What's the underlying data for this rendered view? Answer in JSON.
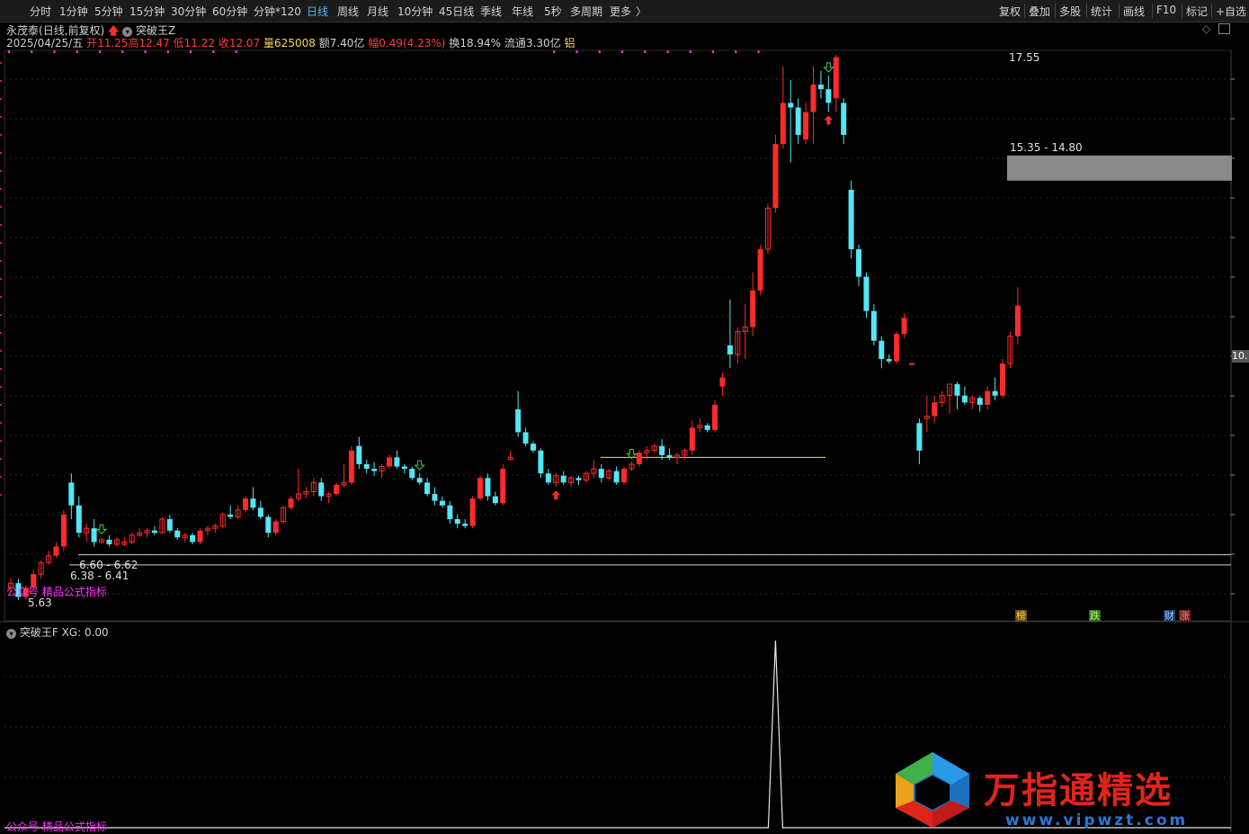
{
  "toolbar": {
    "periods": [
      "分时",
      "1分钟",
      "5分钟",
      "15分钟",
      "30分钟",
      "60分钟",
      "分钟*120",
      "日线",
      "周线",
      "月线",
      "10分钟",
      "45日线",
      "季线",
      "年线",
      "5秒",
      "多周期",
      "更多"
    ],
    "active_period": "日线",
    "tools": [
      "复权",
      "叠加",
      "多股",
      "统计",
      "画线",
      "F10",
      "标记",
      "+自选"
    ]
  },
  "stock": {
    "name": "永茂泰",
    "mode": "(日线,前复权)",
    "indicator": "突破王Z",
    "date": "2025/04/25/五",
    "open_label": "开",
    "open": "11.25",
    "high_label": "高",
    "high": "12.47",
    "low_label": "低",
    "low": "11.22",
    "close_label": "收",
    "close": "12.07",
    "volume_label": "量",
    "volume": "625008",
    "amount_label": "额",
    "amount": "7.40亿",
    "change_label": "幅",
    "change": "0.49(4.23%)",
    "turnover_label": "换",
    "turnover": "18.94%",
    "float_label": "流通",
    "float": "3.30亿",
    "tag": "铝"
  },
  "annotations": {
    "high_price": "17.55",
    "zone_upper": "15.35 - 14.80",
    "zone_lower_1": "6.60 - 6.62",
    "zone_lower_2": "6.38 - 6.41",
    "low_price": "5.63",
    "right_axis_price": "10.",
    "watermark_main": "公众号 精品公式指标",
    "badge_1": "榜",
    "badge_2": "跌",
    "badge_3": "财",
    "badge_4": "涨"
  },
  "indicator_panel": {
    "title": "突破王F",
    "value_label": "XG:",
    "value": "0.00",
    "watermark": "公众号 精品公式指标"
  },
  "brand": {
    "name": "万指通精选",
    "url": "www.vipwzt.com"
  },
  "colors": {
    "up": "#ff2a2a",
    "down": "#54e6f4",
    "magenta": "#ff33ff",
    "yellow_line": "#e8e07a",
    "zone_fill": "#8a8a8a",
    "active_tab": "#4fb8ff",
    "brand_red": "#e0241c",
    "brand_blue": "#2a7ad6"
  },
  "chart_data": {
    "type": "candlestick",
    "x": "trading days (unlabeled)",
    "ohlc": [
      [
        5.9,
        6.1,
        5.8,
        6.0
      ],
      [
        6.0,
        6.1,
        5.63,
        5.7
      ],
      [
        5.7,
        5.95,
        5.65,
        5.9
      ],
      [
        5.9,
        6.3,
        5.85,
        6.2
      ],
      [
        6.2,
        6.5,
        6.1,
        6.45
      ],
      [
        6.45,
        6.7,
        6.4,
        6.6
      ],
      [
        6.6,
        6.9,
        6.55,
        6.8
      ],
      [
        6.8,
        7.6,
        6.7,
        7.5
      ],
      [
        8.2,
        8.4,
        7.4,
        7.7
      ],
      [
        7.7,
        7.9,
        7.0,
        7.1
      ],
      [
        7.1,
        7.3,
        6.9,
        7.2
      ],
      [
        7.2,
        7.4,
        6.8,
        6.9
      ],
      [
        6.9,
        7.0,
        6.85,
        6.95
      ],
      [
        6.95,
        7.05,
        6.8,
        6.85
      ],
      [
        6.85,
        7.0,
        6.8,
        6.95
      ],
      [
        6.85,
        7.0,
        6.8,
        6.9
      ],
      [
        6.9,
        7.1,
        6.85,
        7.05
      ],
      [
        7.05,
        7.2,
        7.0,
        7.1
      ],
      [
        7.1,
        7.2,
        7.0,
        7.15
      ],
      [
        7.15,
        7.25,
        7.05,
        7.1
      ],
      [
        7.1,
        7.45,
        7.1,
        7.4
      ],
      [
        7.4,
        7.5,
        7.1,
        7.15
      ],
      [
        7.15,
        7.2,
        6.95,
        7.0
      ],
      [
        7.0,
        7.1,
        6.9,
        7.05
      ],
      [
        7.05,
        7.1,
        6.85,
        6.9
      ],
      [
        6.9,
        7.2,
        6.85,
        7.15
      ],
      [
        7.15,
        7.25,
        7.05,
        7.2
      ],
      [
        7.2,
        7.3,
        7.1,
        7.25
      ],
      [
        7.25,
        7.55,
        7.2,
        7.5
      ],
      [
        7.5,
        7.7,
        7.4,
        7.45
      ],
      [
        7.45,
        7.7,
        7.4,
        7.6
      ],
      [
        7.6,
        7.9,
        7.55,
        7.85
      ],
      [
        7.85,
        8.1,
        7.6,
        7.65
      ],
      [
        7.65,
        7.8,
        7.4,
        7.45
      ],
      [
        7.45,
        7.5,
        7.0,
        7.1
      ],
      [
        7.1,
        7.4,
        7.05,
        7.35
      ],
      [
        7.35,
        7.7,
        7.3,
        7.65
      ],
      [
        7.65,
        7.9,
        7.6,
        7.85
      ],
      [
        7.85,
        8.5,
        7.8,
        7.95
      ],
      [
        7.95,
        8.1,
        7.85,
        8.0
      ],
      [
        8.0,
        8.3,
        7.9,
        8.2
      ],
      [
        8.2,
        8.3,
        7.8,
        7.9
      ],
      [
        7.9,
        8.0,
        7.75,
        7.95
      ],
      [
        7.95,
        8.2,
        7.9,
        8.15
      ],
      [
        8.15,
        8.6,
        8.1,
        8.2
      ],
      [
        8.2,
        9.0,
        8.15,
        8.9
      ],
      [
        9.0,
        9.2,
        8.5,
        8.6
      ],
      [
        8.6,
        8.7,
        8.4,
        8.5
      ],
      [
        8.5,
        8.65,
        8.35,
        8.45
      ],
      [
        8.45,
        8.6,
        8.3,
        8.55
      ],
      [
        8.55,
        8.8,
        8.5,
        8.75
      ],
      [
        8.75,
        8.9,
        8.5,
        8.55
      ],
      [
        8.55,
        8.6,
        8.4,
        8.5
      ],
      [
        8.5,
        8.55,
        8.25,
        8.3
      ],
      [
        8.3,
        8.4,
        8.15,
        8.2
      ],
      [
        8.2,
        8.3,
        7.9,
        7.95
      ],
      [
        7.95,
        8.1,
        7.7,
        7.8
      ],
      [
        7.8,
        7.9,
        7.65,
        7.7
      ],
      [
        7.7,
        7.8,
        7.3,
        7.4
      ],
      [
        7.4,
        7.5,
        7.2,
        7.3
      ],
      [
        7.3,
        7.4,
        7.2,
        7.25
      ],
      [
        7.25,
        7.9,
        7.2,
        7.85
      ],
      [
        7.85,
        8.35,
        7.8,
        8.3
      ],
      [
        8.3,
        8.4,
        7.8,
        7.9
      ],
      [
        7.9,
        8.0,
        7.7,
        7.75
      ],
      [
        7.75,
        8.6,
        7.7,
        8.5
      ],
      [
        8.7,
        8.9,
        8.7,
        8.75
      ],
      [
        9.8,
        10.2,
        9.2,
        9.3
      ],
      [
        9.3,
        9.4,
        9.0,
        9.05
      ],
      [
        9.05,
        9.1,
        8.85,
        8.9
      ],
      [
        8.9,
        8.95,
        8.3,
        8.4
      ],
      [
        8.4,
        8.5,
        8.15,
        8.2
      ],
      [
        8.2,
        8.4,
        8.1,
        8.35
      ],
      [
        8.35,
        8.45,
        8.15,
        8.2
      ],
      [
        8.2,
        8.35,
        8.1,
        8.3
      ],
      [
        8.3,
        8.35,
        8.15,
        8.25
      ],
      [
        8.25,
        8.45,
        8.2,
        8.4
      ],
      [
        8.4,
        8.7,
        8.3,
        8.5
      ],
      [
        8.5,
        8.6,
        8.2,
        8.3
      ],
      [
        8.3,
        8.5,
        8.25,
        8.45
      ],
      [
        8.45,
        8.55,
        8.15,
        8.2
      ],
      [
        8.2,
        8.55,
        8.15,
        8.5
      ],
      [
        8.5,
        8.65,
        8.45,
        8.6
      ],
      [
        8.6,
        8.9,
        8.55,
        8.85
      ],
      [
        8.85,
        9.0,
        8.7,
        8.9
      ],
      [
        8.9,
        9.05,
        8.85,
        9.0
      ],
      [
        9.0,
        9.15,
        8.7,
        8.8
      ],
      [
        8.8,
        8.95,
        8.7,
        8.75
      ],
      [
        8.75,
        8.85,
        8.6,
        8.8
      ],
      [
        8.8,
        8.95,
        8.7,
        8.9
      ],
      [
        8.9,
        9.55,
        8.8,
        9.4
      ],
      [
        9.4,
        9.6,
        9.3,
        9.45
      ],
      [
        9.45,
        9.5,
        9.3,
        9.35
      ],
      [
        9.35,
        10.0,
        9.3,
        9.9
      ],
      [
        10.3,
        10.6,
        10.1,
        10.5
      ],
      [
        11.2,
        12.2,
        10.7,
        11.0
      ],
      [
        11.0,
        11.6,
        10.8,
        11.5
      ],
      [
        11.5,
        12.1,
        10.9,
        11.6
      ],
      [
        11.6,
        12.8,
        11.4,
        12.4
      ],
      [
        12.4,
        13.4,
        12.3,
        13.3
      ],
      [
        13.3,
        14.3,
        13.2,
        14.2
      ],
      [
        14.2,
        15.8,
        14.1,
        15.6
      ],
      [
        15.6,
        17.3,
        15.5,
        16.5
      ],
      [
        16.5,
        17.0,
        15.2,
        16.4
      ],
      [
        16.4,
        16.6,
        15.6,
        15.8
      ],
      [
        15.7,
        16.5,
        15.6,
        16.3
      ],
      [
        16.3,
        17.3,
        15.6,
        16.9
      ],
      [
        16.9,
        17.2,
        16.6,
        16.8
      ],
      [
        16.8,
        17.1,
        16.3,
        16.5
      ],
      [
        16.6,
        17.55,
        16.3,
        17.5
      ],
      [
        16.5,
        16.6,
        15.6,
        15.8
      ],
      [
        14.6,
        14.8,
        13.1,
        13.3
      ],
      [
        13.3,
        13.4,
        12.5,
        12.7
      ],
      [
        12.7,
        12.8,
        11.8,
        11.95
      ],
      [
        11.95,
        12.1,
        11.2,
        11.3
      ],
      [
        11.3,
        11.4,
        10.7,
        10.9
      ],
      [
        10.9,
        11.0,
        10.8,
        10.85
      ],
      [
        10.85,
        11.5,
        10.8,
        11.45
      ],
      [
        11.45,
        11.9,
        11.35,
        11.8
      ],
      [
        10.8,
        10.8,
        10.8,
        10.8
      ],
      [
        9.5,
        9.6,
        8.6,
        8.9
      ],
      [
        9.6,
        10.1,
        9.3,
        9.65
      ],
      [
        9.65,
        10.1,
        9.5,
        9.95
      ],
      [
        9.95,
        10.2,
        9.85,
        10.1
      ],
      [
        10.1,
        10.3,
        9.7,
        10.35
      ],
      [
        10.35,
        10.4,
        9.8,
        10.1
      ],
      [
        10.1,
        10.3,
        9.9,
        9.95
      ],
      [
        9.95,
        10.1,
        9.8,
        10.05
      ],
      [
        10.05,
        10.1,
        9.75,
        9.9
      ],
      [
        9.9,
        10.3,
        9.8,
        10.2
      ],
      [
        10.2,
        10.5,
        10.0,
        10.1
      ],
      [
        10.1,
        10.9,
        10.05,
        10.8
      ],
      [
        10.8,
        11.5,
        10.7,
        11.4
      ],
      [
        11.4,
        12.47,
        11.22,
        12.07
      ]
    ],
    "annotations": [
      "17.55",
      "15.35 - 14.80",
      "6.60 - 6.62",
      "6.38 - 6.41",
      "5.63"
    ],
    "sub_indicator": {
      "name": "突破王F",
      "series": "XG",
      "current": 0.0,
      "spike_index": 101,
      "spike_value": 1
    }
  }
}
